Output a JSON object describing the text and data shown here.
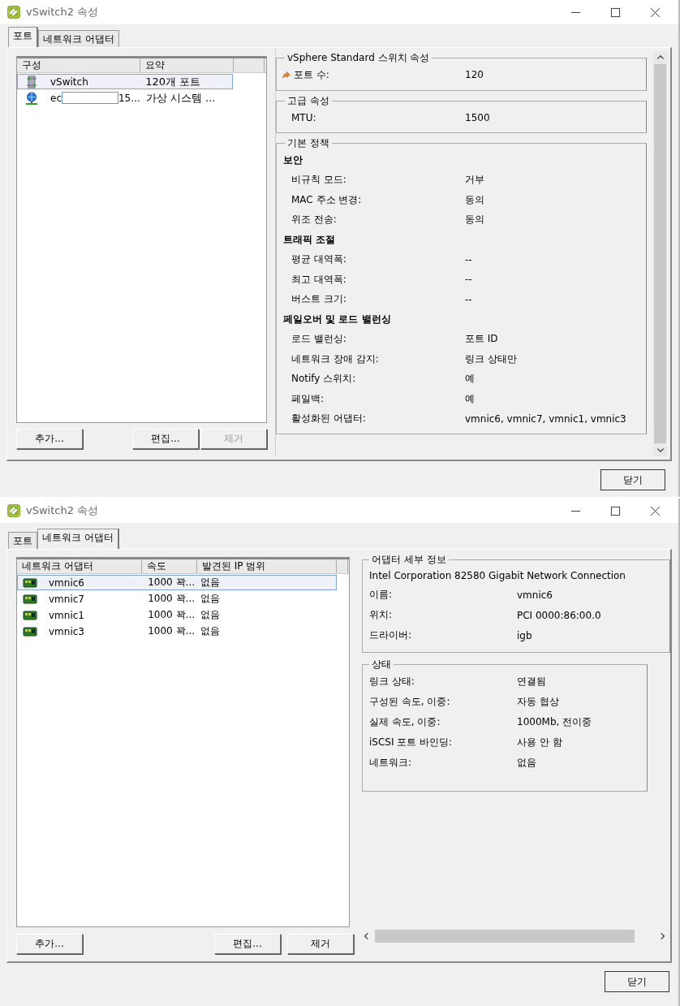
{
  "port_window": {
    "title": "vSwitch2 속성",
    "tabs": [
      {
        "label": "포트",
        "selected": true
      },
      {
        "label": "네트워크 어댑터",
        "selected": false
      }
    ],
    "list": {
      "columns": [
        "구성",
        "요약"
      ],
      "rows": [
        {
          "kind": "switch",
          "name": "vSwitch",
          "summary": "120개 포트",
          "selected": true
        },
        {
          "kind": "network",
          "name_start": "ec",
          "redacted": true,
          "name_end": "15...",
          "summary": "가상 시스템 ...",
          "selected": false
        }
      ]
    },
    "buttons": [
      {
        "label": "추가...",
        "disabled": false
      },
      {
        "label": "편집...",
        "disabled": false
      },
      {
        "label": "제거",
        "disabled": true
      }
    ],
    "groups": [
      {
        "title": "vSphere Standard 스위치 속성",
        "rows": [
          {
            "kind": "icon-property",
            "label": "포트 수:",
            "value": "120"
          }
        ]
      },
      {
        "title": "고급 속성",
        "rows": [
          {
            "kind": "property",
            "label": "MTU:",
            "value": "1500"
          }
        ]
      },
      {
        "title": "기본 정책",
        "rows": [
          {
            "kind": "heading",
            "label": "보안"
          },
          {
            "kind": "property",
            "label": "비규칙 모드:",
            "value": "거부"
          },
          {
            "kind": "property",
            "label": "MAC 주소 변경:",
            "value": "동의"
          },
          {
            "kind": "property",
            "label": "위조 전송:",
            "value": "동의"
          },
          {
            "kind": "heading",
            "label": "트래픽 조절"
          },
          {
            "kind": "property",
            "label": "평균 대역폭:",
            "value": "--"
          },
          {
            "kind": "property",
            "label": "최고 대역폭:",
            "value": "--"
          },
          {
            "kind": "property",
            "label": "버스트 크기:",
            "value": "--"
          },
          {
            "kind": "heading",
            "label": "페일오버 및 로드 밸런싱"
          },
          {
            "kind": "property",
            "label": "로드 밸런싱:",
            "value": "포트 ID"
          },
          {
            "kind": "property",
            "label": "네트워크 장애 감지:",
            "value": "링크 상태만"
          },
          {
            "kind": "property",
            "label": "Notify 스위치:",
            "value": "예"
          },
          {
            "kind": "property",
            "label": "페일백:",
            "value": "예"
          },
          {
            "kind": "property",
            "label": "활성화된 어댑터:",
            "value": "vmnic6, vmnic7, vmnic1, vmnic3"
          }
        ]
      }
    ],
    "close_button": "닫기"
  },
  "adapter_window": {
    "title": "vSwitch2 속성",
    "tabs": [
      {
        "label": "포트",
        "selected": false
      },
      {
        "label": "네트워크 어댑터",
        "selected": true
      }
    ],
    "list": {
      "columns": [
        "네트워크 어댑터",
        "속도",
        "발견된 IP 범위"
      ],
      "rows": [
        {
          "name": "vmnic6",
          "speed": "1000 꽉...",
          "ip_range": "없음",
          "selected": true
        },
        {
          "name": "vmnic7",
          "speed": "1000 꽉...",
          "ip_range": "없음",
          "selected": false
        },
        {
          "name": "vmnic1",
          "speed": "1000 꽉...",
          "ip_range": "없음",
          "selected": false
        },
        {
          "name": "vmnic3",
          "speed": "1000 꽉...",
          "ip_range": "없음",
          "selected": false
        }
      ]
    },
    "buttons": [
      {
        "label": "추가...",
        "disabled": false
      },
      {
        "label": "편집...",
        "disabled": false
      },
      {
        "label": "제거",
        "disabled": false
      }
    ],
    "details": {
      "title": "어댑터 세부 정보",
      "description": "Intel Corporation 82580 Gigabit Network Connection",
      "rows": [
        {
          "label": "이름:",
          "value": "vmnic6"
        },
        {
          "label": "위치:",
          "value": "PCI 0000:86:00.0"
        },
        {
          "label": "드라이버:",
          "value": "igb"
        }
      ]
    },
    "status": {
      "title": "상태",
      "rows": [
        {
          "label": "링크 상태:",
          "value": "연결됨"
        },
        {
          "label": "구성된 속도, 이중:",
          "value": "자동 협상"
        },
        {
          "label": "실제 속도, 이중:",
          "value": "1000Mb, 전이중"
        },
        {
          "label": "iSCSI 포트 바인딩:",
          "value": "사용 안 함"
        },
        {
          "label": "네트워크:",
          "value": "없음"
        }
      ]
    },
    "close_button": "닫기"
  }
}
